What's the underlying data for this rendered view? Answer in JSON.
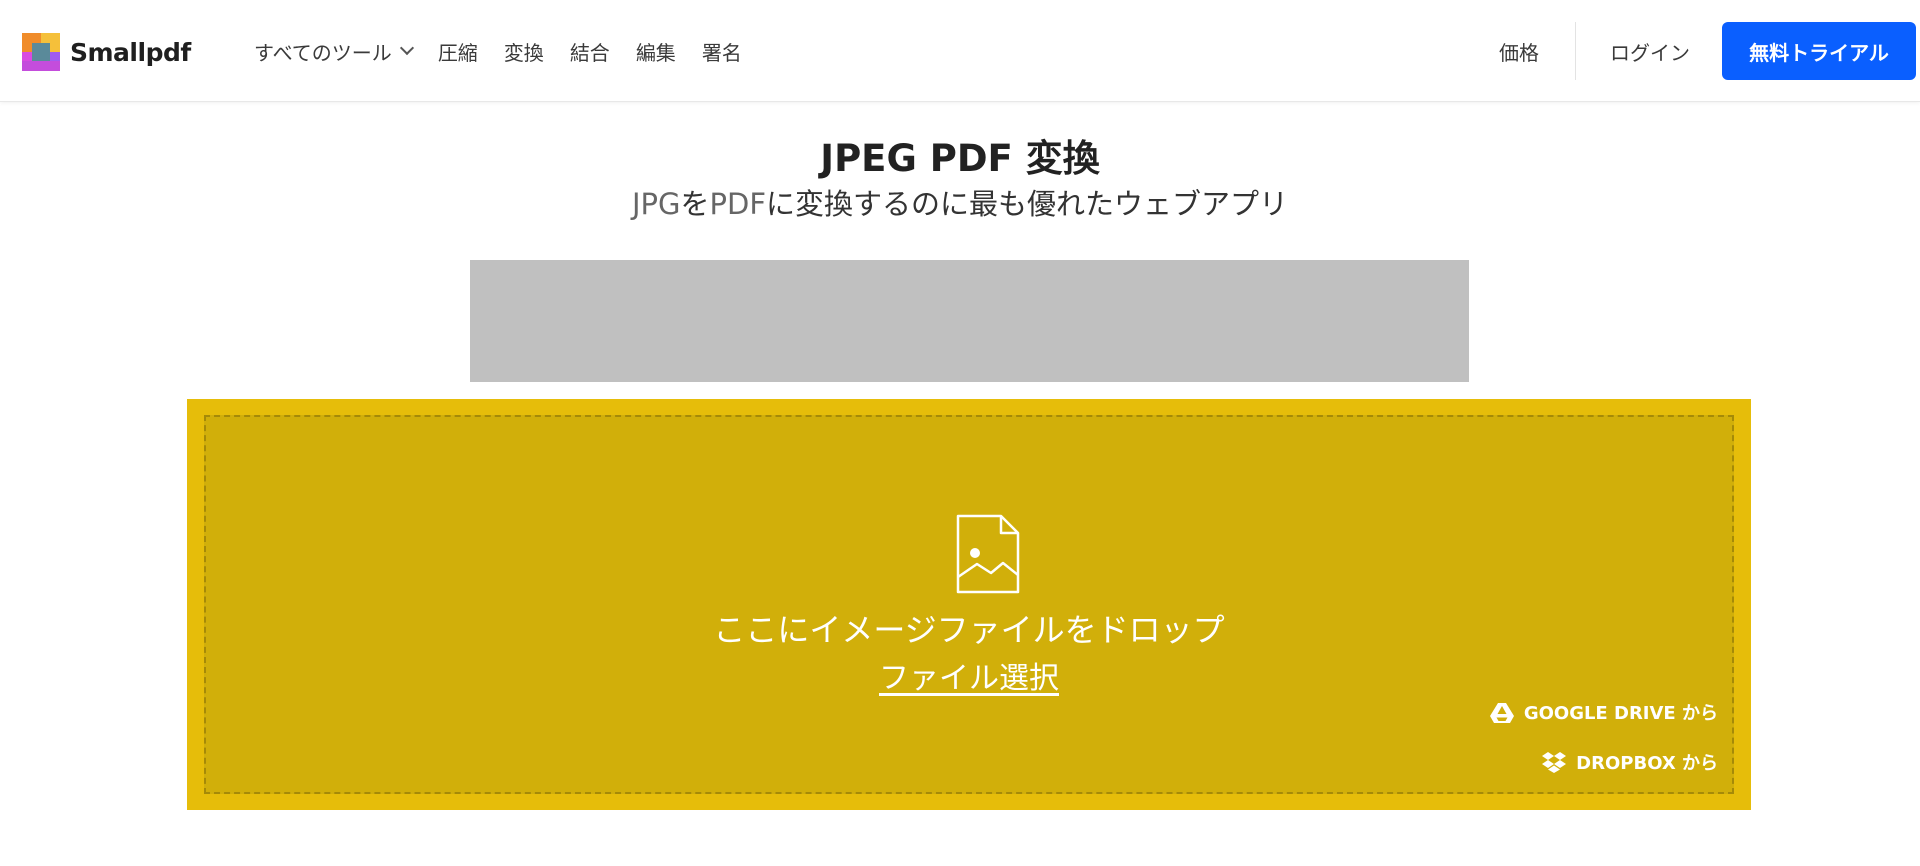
{
  "brand": {
    "name": "Smallpdf"
  },
  "nav": {
    "items": [
      {
        "label": "すべてのツール"
      },
      {
        "label": "圧縮"
      },
      {
        "label": "変換"
      },
      {
        "label": "結合"
      },
      {
        "label": "編集"
      },
      {
        "label": "署名"
      }
    ],
    "price": "価格",
    "login": "ログイン",
    "trial": "無料トライアル"
  },
  "hero": {
    "title": "JPEG PDF 変換",
    "subtitle": {
      "part1": "JPG",
      "part2": "を",
      "part3": "PDF",
      "part4": "に変換するのに最も優れたウェブアプリ"
    }
  },
  "dropzone": {
    "drop_text": "ここにイメージファイルをドロップ",
    "choose_file": "ファイル選択",
    "google_drive": "GOOGLE DRIVE から",
    "dropbox": "DROPBOX から"
  },
  "colors": {
    "accent": "#0a5fff",
    "dropzone_outer": "#e6bd0a",
    "dropzone_inner": "#d1af0a",
    "ad_placeholder": "#c0c0c0"
  },
  "icons": {
    "file": "image-file-icon",
    "chevron": "chevron-down-icon",
    "gdrive": "google-drive-icon",
    "dropbox": "dropbox-icon"
  }
}
